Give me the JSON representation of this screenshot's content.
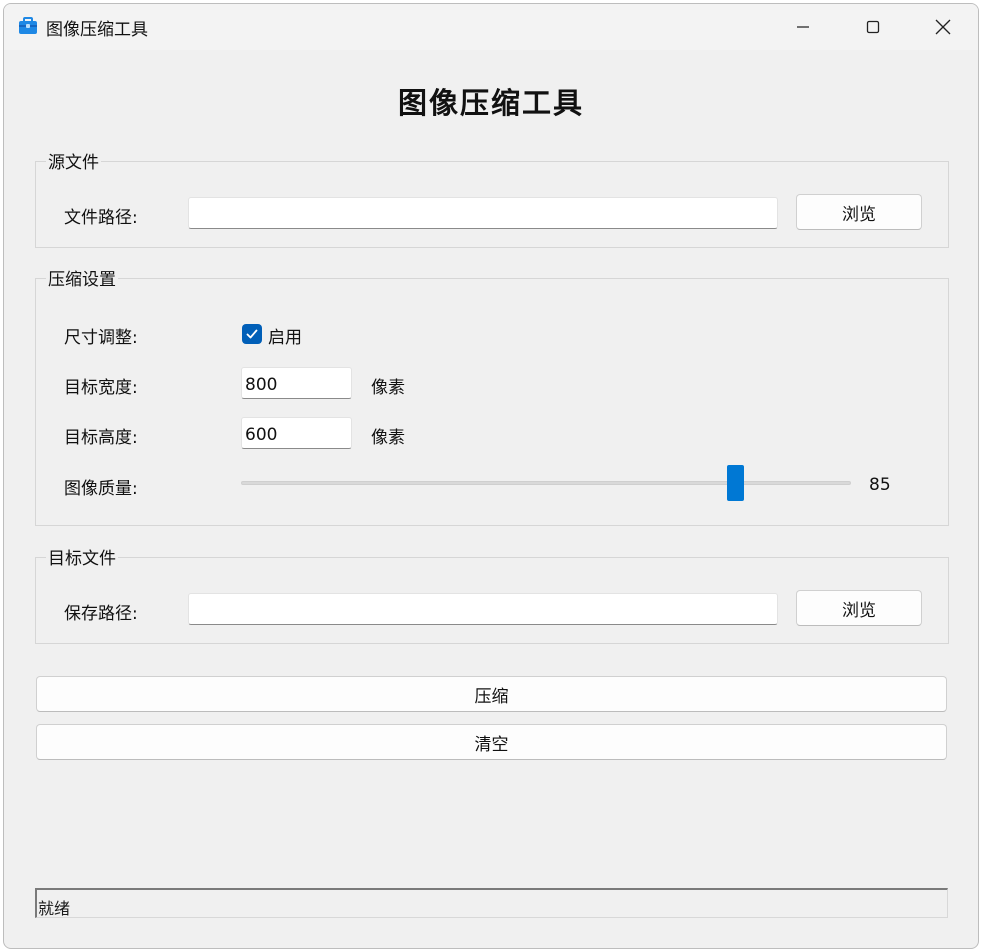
{
  "window": {
    "title": "图像压缩工具",
    "app_icon": "toolbox-icon",
    "controls": [
      "minimize-icon",
      "maximize-icon",
      "close-icon"
    ]
  },
  "heading": "图像压缩工具",
  "source_group": {
    "title": "源文件",
    "path_label": "文件路径:",
    "path_value": "",
    "browse_label": "浏览"
  },
  "settings_group": {
    "title": "压缩设置",
    "resize_label": "尺寸调整:",
    "resize_checkbox_label": "启用",
    "resize_checked": true,
    "width_label": "目标宽度:",
    "width_value": "800",
    "width_unit": "像素",
    "height_label": "目标高度:",
    "height_value": "600",
    "height_unit": "像素",
    "quality_label": "图像质量:",
    "quality_value": "85",
    "quality_fraction": 0.82
  },
  "target_group": {
    "title": "目标文件",
    "path_label": "保存路径:",
    "path_value": "",
    "browse_label": "浏览"
  },
  "actions": {
    "compress_label": "压缩",
    "clear_label": "清空"
  },
  "status": {
    "text": "就绪"
  },
  "colors": {
    "accent": "#0078d4",
    "checkbox": "#005fb8",
    "window_bg": "#f0f0f0"
  }
}
